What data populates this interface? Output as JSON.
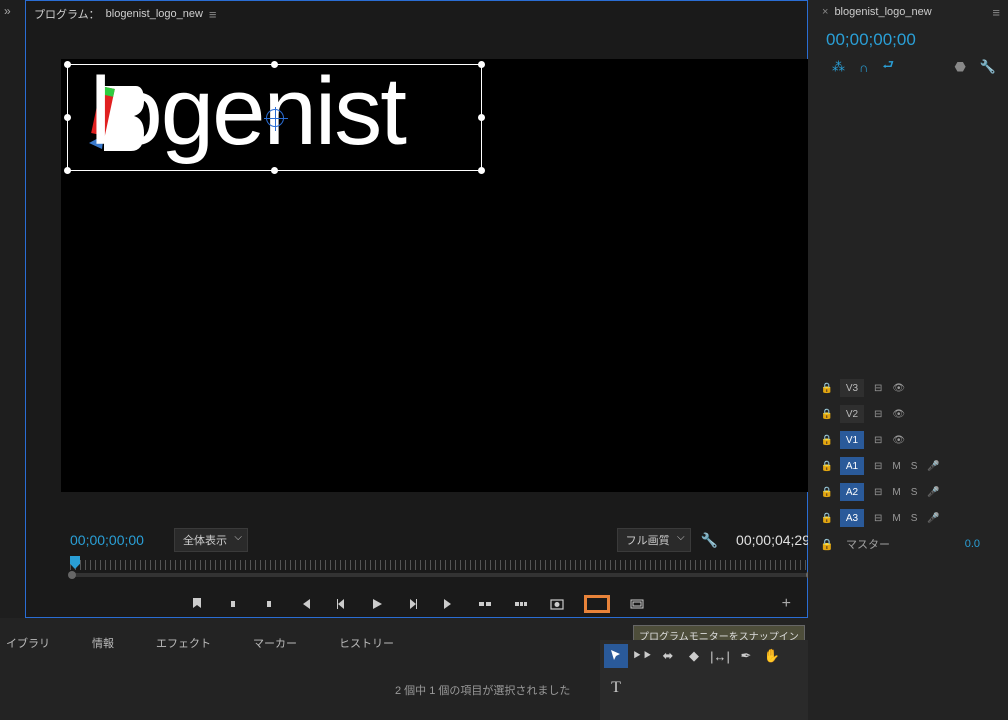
{
  "program": {
    "title_prefix": "プログラム：",
    "title": "blogenist_logo_new",
    "current_time": "00;00;00;00",
    "zoom_label": "全体表示",
    "quality_label": "フル画質",
    "duration": "00;00;04;29",
    "logo_text": "logenist"
  },
  "tooltip": "プログラムモニターをスナップイン",
  "tabs": {
    "library": "イブラリ",
    "info": "情報",
    "effects": "エフェクト",
    "markers": "マーカー",
    "history": "ヒストリー"
  },
  "status": "2 個中 1 個の項目が選択されました",
  "sequence": {
    "name": "blogenist_logo_new",
    "time": "00;00;00;00"
  },
  "tracks": {
    "v3": "V3",
    "v2": "V2",
    "v1": "V1",
    "a1": "A1",
    "a2": "A2",
    "a3": "A3",
    "m": "M",
    "s": "S",
    "master": "マスター",
    "master_val": "0.0"
  }
}
